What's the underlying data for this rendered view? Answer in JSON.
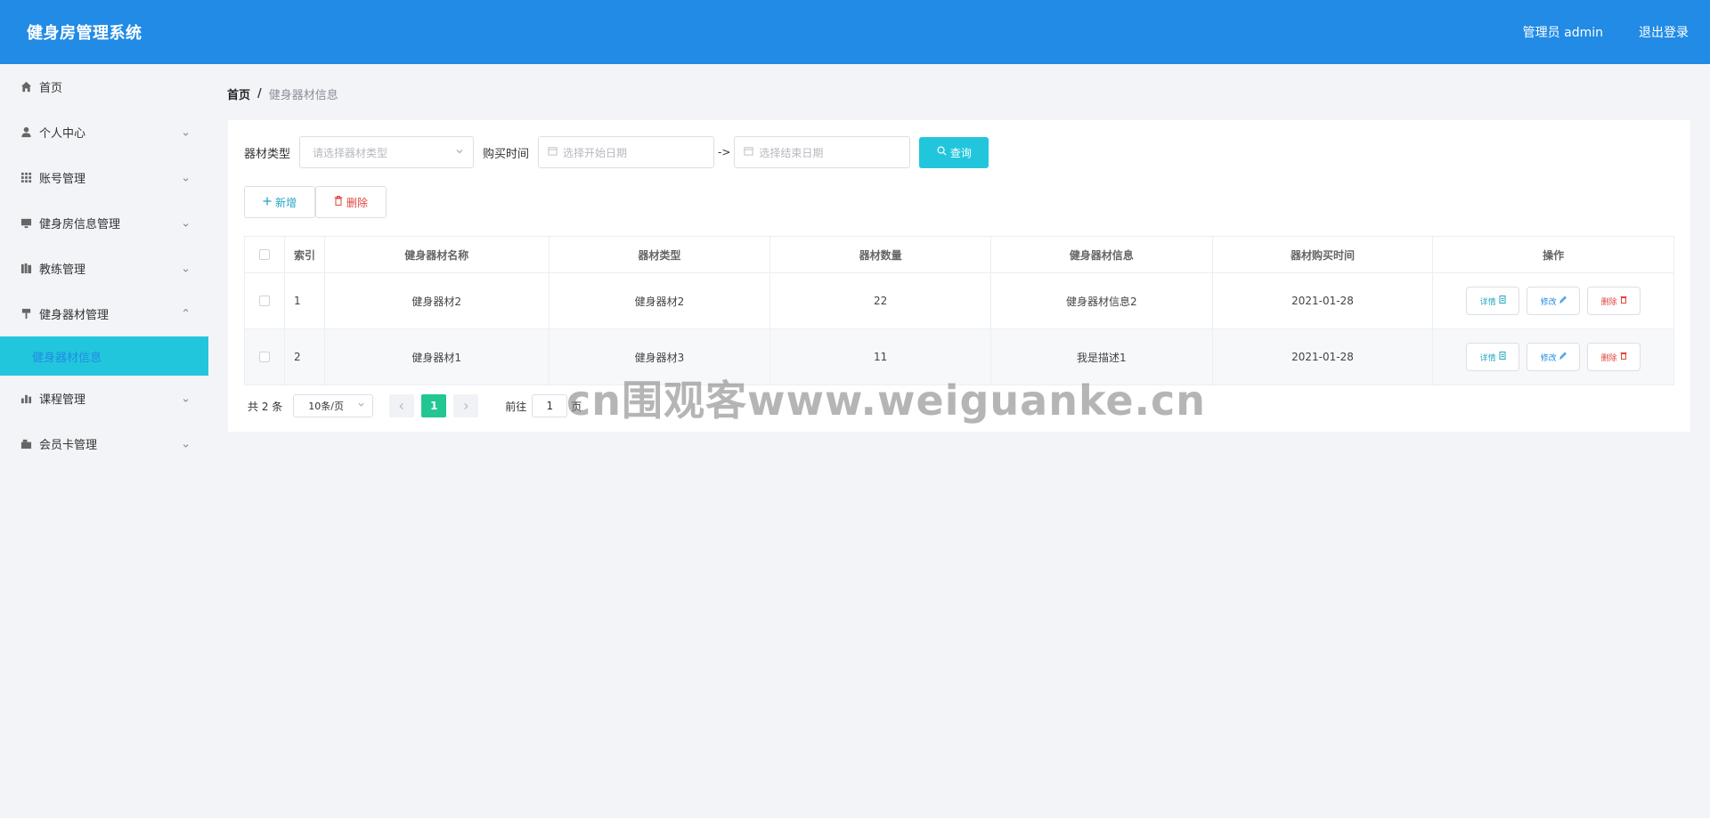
{
  "header": {
    "title": "健身房管理系统",
    "user": "管理员 admin",
    "logout": "退出登录",
    "bg_color": "#218be5"
  },
  "sidebar": {
    "items": [
      {
        "label": "首页",
        "icon": "home-icon",
        "expandable": false
      },
      {
        "label": "个人中心",
        "icon": "user-icon",
        "expandable": true,
        "chevron": "⌄"
      },
      {
        "label": "账号管理",
        "icon": "grid-icon",
        "expandable": true,
        "chevron": "⌄"
      },
      {
        "label": "健身房信息管理",
        "icon": "monitor-icon",
        "expandable": true,
        "chevron": "⌄"
      },
      {
        "label": "教练管理",
        "icon": "book-icon",
        "expandable": true,
        "chevron": "⌄"
      },
      {
        "label": "健身器材管理",
        "icon": "brush-icon",
        "expandable": true,
        "expanded": true,
        "chevron": "⌃"
      },
      {
        "label": "课程管理",
        "icon": "chart-icon",
        "expandable": true,
        "chevron": "⌄"
      },
      {
        "label": "会员卡管理",
        "icon": "card-icon",
        "expandable": true,
        "chevron": "⌄"
      }
    ],
    "active_sub": "健身器材信息",
    "active_bg": "#22c6dc"
  },
  "breadcrumb": {
    "home": "首页",
    "sep": "/",
    "current": "健身器材信息"
  },
  "search": {
    "type_label": "器材类型",
    "type_placeholder": "请选择器材类型",
    "time_label": "购买时间",
    "start_placeholder": "选择开始日期",
    "range_sep": "->",
    "end_placeholder": "选择结束日期",
    "query_label": "查询"
  },
  "actions": {
    "add_label": "新增",
    "delete_label": "删除"
  },
  "table": {
    "columns": [
      "索引",
      "健身器材名称",
      "器材类型",
      "器材数量",
      "健身器材信息",
      "器材购买时间",
      "操作"
    ],
    "rows": [
      {
        "index": "1",
        "name": "健身器材2",
        "type": "健身器材2",
        "count": "22",
        "info": "健身器材信息2",
        "date": "2021-01-28"
      },
      {
        "index": "2",
        "name": "健身器材1",
        "type": "健身器材3",
        "count": "11",
        "info": "我是描述1",
        "date": "2021-01-28"
      }
    ],
    "op_detail": "详情",
    "op_edit": "修改",
    "op_delete": "删除"
  },
  "pagination": {
    "total": "共 2 条",
    "page_size": "10条/页",
    "current_page": "1",
    "goto_label": "前往",
    "goto_value": "1",
    "page_suffix": "页"
  },
  "watermark": "cn围观客www.weiguanke.cn"
}
